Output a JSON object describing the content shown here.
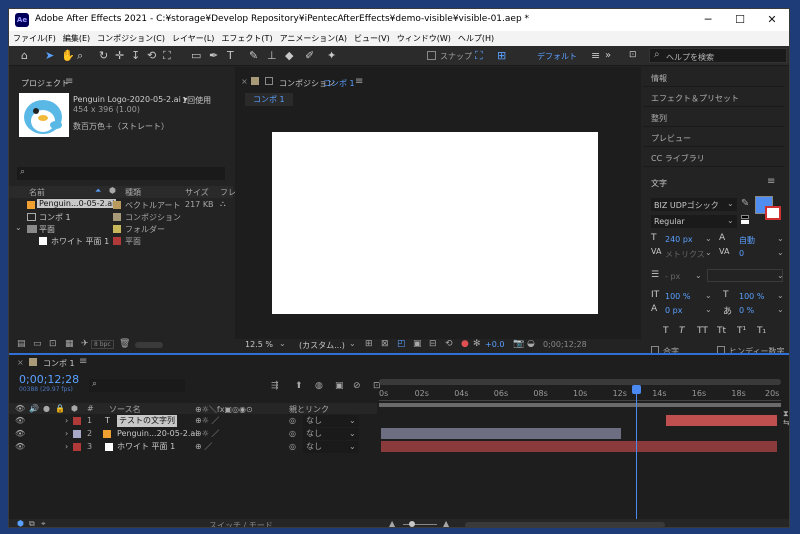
{
  "window": {
    "title": "Adobe After Effects 2021 - C:¥storage¥Develop Repository¥iPentecAfterEffects¥demo-visible¥visible-01.aep *",
    "app_icon": "Ae"
  },
  "menu": [
    "ファイル(F)",
    "編集(E)",
    "コンポジション(C)",
    "レイヤー(L)",
    "エフェクト(T)",
    "アニメーション(A)",
    "ビュー(V)",
    "ウィンドウ(W)",
    "ヘルプ(H)"
  ],
  "toolbar": {
    "snap_label": "スナップ",
    "workspace": "デフォルト",
    "search_placeholder": "ヘルプを検索"
  },
  "project": {
    "title": "プロジェクト",
    "preview_name": "Penguin Logo-2020-05-2.ai ▾",
    "usage": "1回使用",
    "dimensions": "454 x 396 (1.00)",
    "color_info": "数百万色＋（ストレート）",
    "search_placeholder": "",
    "columns": [
      "名前",
      "種類",
      "サイズ",
      "フレ"
    ],
    "items": [
      {
        "name": "Penguin...0-05-2.ai",
        "type": "ベクトルアート",
        "size": "217 KB",
        "color": "#b89a5a"
      },
      {
        "name": "コンポ 1",
        "type": "コンポジション",
        "size": "",
        "color": "#a89a78"
      },
      {
        "name": "平面",
        "type": "フォルダー",
        "size": "",
        "color": "#c9b85a"
      },
      {
        "name": "ホワイト 平面 1",
        "type": "平面",
        "size": "",
        "color": "#b03a3a"
      }
    ],
    "bpc": "8 bpc"
  },
  "composition": {
    "tab_label": "コンポジション",
    "comp_name": "コンポ 1",
    "breadcrumb": "コンポ 1",
    "zoom": "12.5 %",
    "resolution": "(カスタム...)",
    "exposure": "+0.0",
    "timecode": "0;00;12;28"
  },
  "right_panel": {
    "sections": [
      "情報",
      "エフェクト＆プリセット",
      "整列",
      "プレビュー",
      "CC ライブラリ"
    ],
    "char_title": "文字",
    "font_family": "BIZ UDPゴシック",
    "font_style": "Regular",
    "font_size": "240 px",
    "leading": "自動",
    "kerning": "メトリクス",
    "tracking": "0",
    "stroke_width": "- px",
    "vscale": "100 %",
    "hscale": "100 %",
    "baseline": "0 px",
    "tsume": "0 %",
    "fill_color": "#4f8ef0",
    "faux_bold": "合字",
    "hindi": "ヒンディー数字",
    "style_buttons": [
      "T",
      "T",
      "TT",
      "Tt",
      "T¹",
      "T₁"
    ]
  },
  "timeline": {
    "tab_label": "コンポ 1",
    "timecode": "0;00;12;28",
    "frame_info": "00388 (29.97 fps)",
    "col_source": "ソース名",
    "col_parent": "親とリンク",
    "switch_mode": "スイッチ / モード",
    "ruler": [
      "0s",
      "02s",
      "04s",
      "06s",
      "08s",
      "10s",
      "12s",
      "14s",
      "16s",
      "18s",
      "20s"
    ],
    "layers": [
      {
        "num": "1",
        "name": "テストの文字列",
        "parent": "なし",
        "color": "#b03a3a",
        "type_icon": "T"
      },
      {
        "num": "2",
        "name": "Penguin...20-05-2.ai",
        "parent": "なし",
        "color": "#a8a8c8",
        "type_icon": "ai"
      },
      {
        "num": "3",
        "name": "ホワイト 平面 1",
        "parent": "なし",
        "color": "#b03a3a",
        "type_icon": "solid"
      }
    ],
    "layer_bar_colors": {
      "text": "#c05050",
      "penguin": "#6e6e82",
      "solid": "#8a3a3a"
    },
    "playhead_time_s": 12.9,
    "duration_s": 20,
    "layer_spans_s": [
      [
        14.4,
        20
      ],
      [
        0,
        12.1
      ],
      [
        0,
        20
      ]
    ]
  }
}
